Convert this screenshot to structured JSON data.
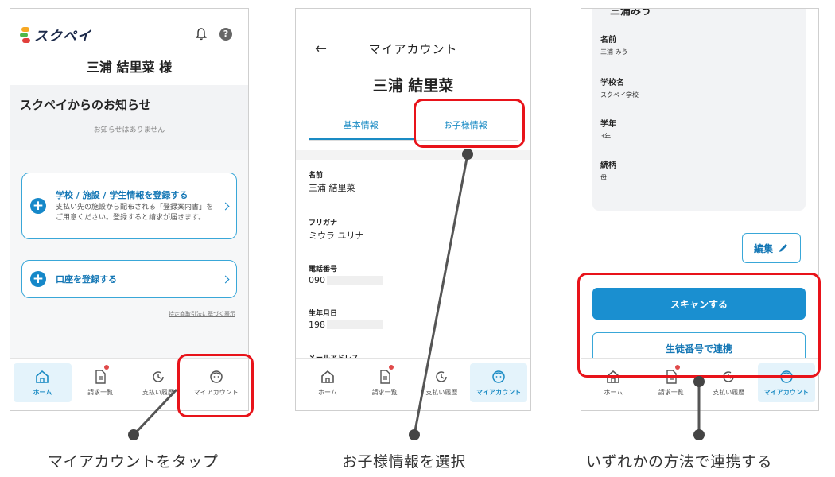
{
  "screen1": {
    "logo_text": "スクペイ",
    "user_name": "三浦 結里菜 様",
    "notice_title": "スクペイからのお知らせ",
    "notice_empty": "お知らせはありません",
    "card_school": {
      "title": "学校 / 施設 / 学生情報を登録する",
      "desc": "支払い先の施設から配布される「登録案内書」をご用意ください。登録すると請求が届きます。"
    },
    "card_account": {
      "title": "口座を登録する"
    },
    "legal_link": "特定商取引法に基づく表示"
  },
  "nav": {
    "home": "ホーム",
    "billing": "請求一覧",
    "history": "支払い履歴",
    "account": "マイアカウント"
  },
  "screen2": {
    "title": "マイアカウント",
    "name": "三浦 結里菜",
    "tab_basic": "基本情報",
    "tab_child": "お子様情報",
    "fields": [
      {
        "label": "名前",
        "value": "三浦 結里菜"
      },
      {
        "label": "フリガナ",
        "value": "ミウラ ユリナ"
      },
      {
        "label": "電話番号",
        "value": "090"
      },
      {
        "label": "生年月日",
        "value": "198"
      },
      {
        "label": "メールアドレス",
        "value": ""
      }
    ]
  },
  "screen3": {
    "cut_title": "三浦みう",
    "fields": [
      {
        "label": "名前",
        "value": "三浦 みう"
      },
      {
        "label": "学校名",
        "value": "スクペイ学校"
      },
      {
        "label": "学年",
        "value": "3年"
      },
      {
        "label": "続柄",
        "value": "母"
      }
    ],
    "edit_label": "編集",
    "scan_label": "スキャンする",
    "student_label": "生徒番号で連携"
  },
  "captions": {
    "step1": "マイアカウントをタップ",
    "step2": "お子様情報を選択",
    "step3": "いずれかの方法で連携する"
  },
  "colors": {
    "accent": "#1a8fd0",
    "highlight": "#e8131a",
    "badge": "#e04a4a"
  }
}
